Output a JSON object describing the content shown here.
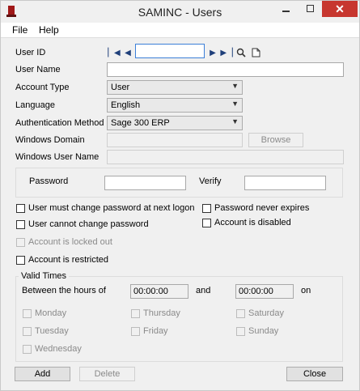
{
  "window": {
    "title": "SAMINC - Users"
  },
  "menu": {
    "file": "File",
    "help": "Help"
  },
  "form": {
    "user_id": {
      "label": "User ID",
      "value": ""
    },
    "user_name": {
      "label": "User Name",
      "value": ""
    },
    "account_type": {
      "label": "Account Type",
      "value": "User"
    },
    "language": {
      "label": "Language",
      "value": "English"
    },
    "auth_method": {
      "label": "Authentication Method",
      "value": "Sage 300 ERP"
    },
    "windows_domain": {
      "label": "Windows Domain",
      "value": "",
      "browse_label": "Browse"
    },
    "windows_user_name": {
      "label": "Windows User Name",
      "value": ""
    },
    "password": {
      "label": "Password",
      "value": ""
    },
    "verify": {
      "label": "Verify",
      "value": ""
    }
  },
  "options": {
    "must_change": "User must change password at next logon",
    "never_expires": "Password never expires",
    "cannot_change": "User cannot change password",
    "disabled": "Account is disabled",
    "locked_out": "Account is locked out",
    "restricted": "Account is restricted"
  },
  "valid_times": {
    "title": "Valid Times",
    "between": "Between the hours of",
    "from": "00:00:00",
    "and": "and",
    "to": "00:00:00",
    "on": "on",
    "days": {
      "monday": "Monday",
      "tuesday": "Tuesday",
      "wednesday": "Wednesday",
      "thursday": "Thursday",
      "friday": "Friday",
      "saturday": "Saturday",
      "sunday": "Sunday"
    }
  },
  "buttons": {
    "add": "Add",
    "delete": "Delete",
    "close": "Close"
  }
}
